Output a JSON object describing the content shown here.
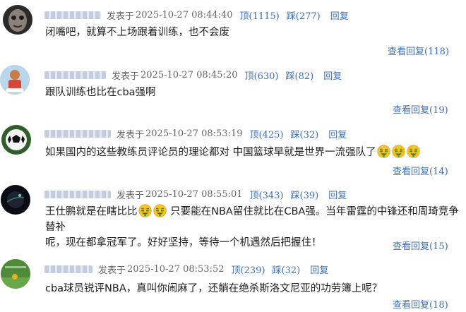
{
  "posted_label": "发表于",
  "up_label": "顶",
  "down_label": "踩",
  "reply_label": "回复",
  "view_replies_label": "查看回复",
  "comments": [
    {
      "time": "2025-10-27 08:44:40",
      "up": "(1115)",
      "down": "(277)",
      "text": "闭嘴吧，就算不上场跟着训练，也不会废",
      "replies": "(118)"
    },
    {
      "time": "2025-10-27 08:45:20",
      "up": "(630)",
      "down": "(82)",
      "text": "跟队训练也比在cba强啊",
      "replies": "(19)"
    },
    {
      "time": "2025-10-27 08:53:19",
      "up": "(425)",
      "down": "(32)",
      "text": "如果国内的这些教练员评论员的理论都对 中国篮球早就是世界一流强队了",
      "replies": "(14)"
    },
    {
      "time": "2025-10-27 08:55:01",
      "up": "(343)",
      "down": "(39)",
      "text_a": "王仕鹏就是在瞎比比",
      "text_b": "只要能在NBA留住就比在CBA强。当年雷霆的中锋还和周琦竞争替补",
      "text_c": "呢，现在都拿冠军了。好好坚持，等待一个机遇然后把握住！",
      "replies": "(15)"
    },
    {
      "time": "2025-10-27 08:53:52",
      "up": "(239)",
      "down": "(32)",
      "text": "cba球员锐评NBA，真叫你闹麻了，还躺在绝杀斯洛文尼亚的功劳簿上呢？",
      "replies": "(18)"
    }
  ],
  "icons": {
    "avatar_1": "dark-face-avatar",
    "avatar_2": "cartoon-player-avatar",
    "avatar_3": "soccer-ball-avatar",
    "avatar_4": "dark-planet-avatar",
    "avatar_5": "field-photo-avatar",
    "emoji": "money-mouth-face-emoji"
  },
  "colors": {
    "link": "#3c6fb6",
    "meta": "#666666",
    "text": "#1e1e1e"
  }
}
